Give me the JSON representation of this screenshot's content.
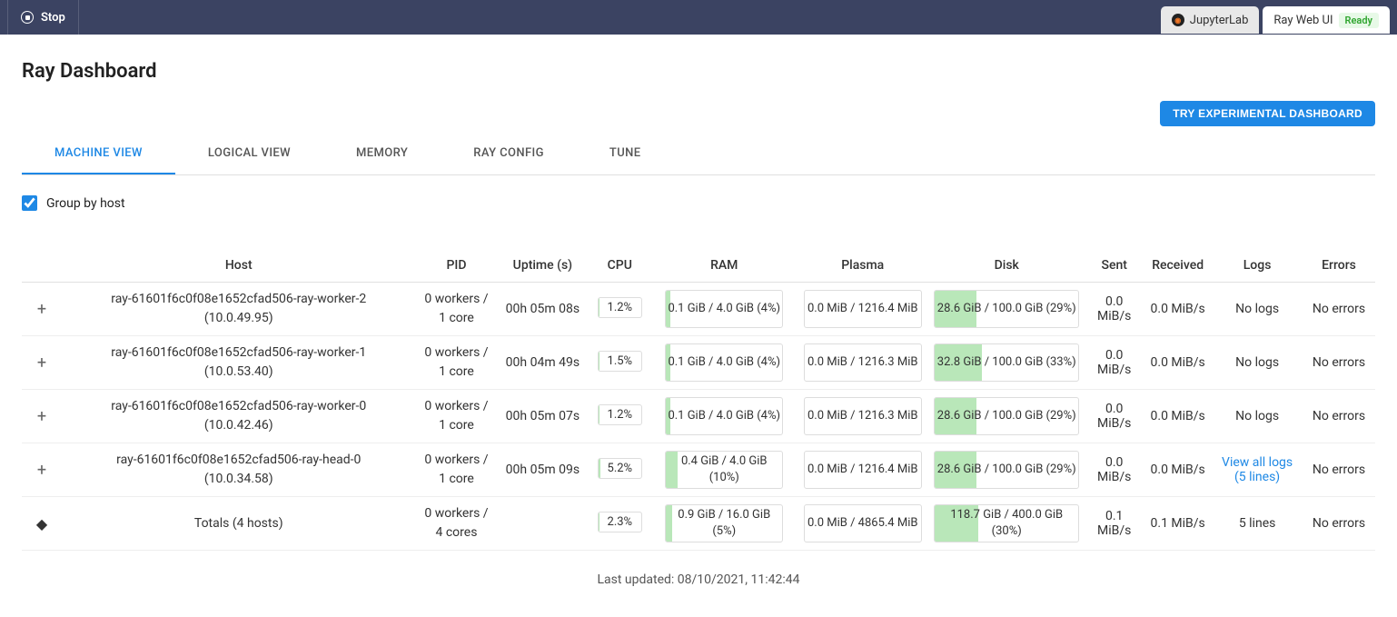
{
  "topbar": {
    "stop_label": "Stop",
    "tabs": [
      {
        "label": "JupyterLab",
        "active": false
      },
      {
        "label": "Ray Web UI",
        "active": true,
        "badge": "Ready"
      }
    ]
  },
  "page": {
    "title": "Ray Dashboard",
    "experimental_button": "TRY EXPERIMENTAL DASHBOARD"
  },
  "nav_tabs": [
    {
      "label": "MACHINE VIEW",
      "active": true
    },
    {
      "label": "LOGICAL VIEW",
      "active": false
    },
    {
      "label": "MEMORY",
      "active": false
    },
    {
      "label": "RAY CONFIG",
      "active": false
    },
    {
      "label": "TUNE",
      "active": false
    }
  ],
  "controls": {
    "group_by_host_label": "Group by host",
    "group_by_host_checked": true
  },
  "table": {
    "headers": {
      "host": "Host",
      "pid": "PID",
      "uptime": "Uptime (s)",
      "cpu": "CPU",
      "ram": "RAM",
      "plasma": "Plasma",
      "disk": "Disk",
      "sent": "Sent",
      "received": "Received",
      "logs": "Logs",
      "errors": "Errors"
    },
    "rows": [
      {
        "host_name": "ray-61601f6c0f08e1652cfad506-ray-worker-2",
        "host_ip": "(10.0.49.95)",
        "pid": "0 workers / 1 core",
        "uptime": "00h 05m 08s",
        "cpu": "1.2%",
        "cpu_fill": 1.2,
        "ram": "0.1 GiB / 4.0 GiB (4%)",
        "ram_fill": 4,
        "plasma": "0.0 MiB / 1216.4 MiB",
        "plasma_fill": 0,
        "disk": "28.6 GiB / 100.0 GiB (29%)",
        "disk_fill": 29,
        "sent": "0.0 MiB/s",
        "received": "0.0 MiB/s",
        "logs": "No logs",
        "logs_link": false,
        "errors": "No errors"
      },
      {
        "host_name": "ray-61601f6c0f08e1652cfad506-ray-worker-1",
        "host_ip": "(10.0.53.40)",
        "pid": "0 workers / 1 core",
        "uptime": "00h 04m 49s",
        "cpu": "1.5%",
        "cpu_fill": 1.5,
        "ram": "0.1 GiB / 4.0 GiB (4%)",
        "ram_fill": 4,
        "plasma": "0.0 MiB / 1216.3 MiB",
        "plasma_fill": 0,
        "disk": "32.8 GiB / 100.0 GiB (33%)",
        "disk_fill": 33,
        "sent": "0.0 MiB/s",
        "received": "0.0 MiB/s",
        "logs": "No logs",
        "logs_link": false,
        "errors": "No errors"
      },
      {
        "host_name": "ray-61601f6c0f08e1652cfad506-ray-worker-0",
        "host_ip": "(10.0.42.46)",
        "pid": "0 workers / 1 core",
        "uptime": "00h 05m 07s",
        "cpu": "1.2%",
        "cpu_fill": 1.2,
        "ram": "0.1 GiB / 4.0 GiB (4%)",
        "ram_fill": 4,
        "plasma": "0.0 MiB / 1216.3 MiB",
        "plasma_fill": 0,
        "disk": "28.6 GiB / 100.0 GiB (29%)",
        "disk_fill": 29,
        "sent": "0.0 MiB/s",
        "received": "0.0 MiB/s",
        "logs": "No logs",
        "logs_link": false,
        "errors": "No errors"
      },
      {
        "host_name": "ray-61601f6c0f08e1652cfad506-ray-head-0",
        "host_ip": "(10.0.34.58)",
        "pid": "0 workers / 1 core",
        "uptime": "00h 05m 09s",
        "cpu": "5.2%",
        "cpu_fill": 5.2,
        "ram": "0.4 GiB / 4.0 GiB (10%)",
        "ram_fill": 10,
        "plasma": "0.0 MiB / 1216.4 MiB",
        "plasma_fill": 0,
        "disk": "28.6 GiB / 100.0 GiB (29%)",
        "disk_fill": 29,
        "sent": "0.0 MiB/s",
        "received": "0.0 MiB/s",
        "logs": "View all logs (5 lines)",
        "logs_link": true,
        "errors": "No errors"
      }
    ],
    "totals": {
      "label": "Totals (4 hosts)",
      "pid": "0 workers / 4 cores",
      "uptime": "",
      "cpu": "2.3%",
      "cpu_fill": 2.3,
      "ram": "0.9 GiB / 16.0 GiB (5%)",
      "ram_fill": 5,
      "plasma": "0.0 MiB / 4865.4 MiB",
      "plasma_fill": 0,
      "disk": "118.7 GiB / 400.0 GiB (30%)",
      "disk_fill": 30,
      "sent": "0.1 MiB/s",
      "received": "0.1 MiB/s",
      "logs": "5 lines",
      "errors": "No errors"
    }
  },
  "footer": {
    "last_updated": "Last updated: 08/10/2021, 11:42:44"
  },
  "chart_data": {
    "type": "table",
    "title": "Ray Dashboard — Machine View",
    "columns": [
      "Host",
      "PID",
      "Uptime (s)",
      "CPU",
      "RAM",
      "Plasma",
      "Disk",
      "Sent",
      "Received",
      "Logs",
      "Errors"
    ],
    "rows": [
      [
        "ray-...-worker-2 (10.0.49.95)",
        "0 workers / 1 core",
        "00h 05m 08s",
        "1.2%",
        "0.1/4.0 GiB (4%)",
        "0.0/1216.4 MiB",
        "28.6/100.0 GiB (29%)",
        "0.0 MiB/s",
        "0.0 MiB/s",
        "No logs",
        "No errors"
      ],
      [
        "ray-...-worker-1 (10.0.53.40)",
        "0 workers / 1 core",
        "00h 04m 49s",
        "1.5%",
        "0.1/4.0 GiB (4%)",
        "0.0/1216.3 MiB",
        "32.8/100.0 GiB (33%)",
        "0.0 MiB/s",
        "0.0 MiB/s",
        "No logs",
        "No errors"
      ],
      [
        "ray-...-worker-0 (10.0.42.46)",
        "0 workers / 1 core",
        "00h 05m 07s",
        "1.2%",
        "0.1/4.0 GiB (4%)",
        "0.0/1216.3 MiB",
        "28.6/100.0 GiB (29%)",
        "0.0 MiB/s",
        "0.0 MiB/s",
        "No logs",
        "No errors"
      ],
      [
        "ray-...-head-0 (10.0.34.58)",
        "0 workers / 1 core",
        "00h 05m 09s",
        "5.2%",
        "0.4/4.0 GiB (10%)",
        "0.0/1216.4 MiB",
        "28.6/100.0 GiB (29%)",
        "0.0 MiB/s",
        "0.0 MiB/s",
        "View all logs (5 lines)",
        "No errors"
      ],
      [
        "Totals (4 hosts)",
        "0 workers / 4 cores",
        "",
        "2.3%",
        "0.9/16.0 GiB (5%)",
        "0.0/4865.4 MiB",
        "118.7/400.0 GiB (30%)",
        "0.1 MiB/s",
        "0.1 MiB/s",
        "5 lines",
        "No errors"
      ]
    ]
  }
}
